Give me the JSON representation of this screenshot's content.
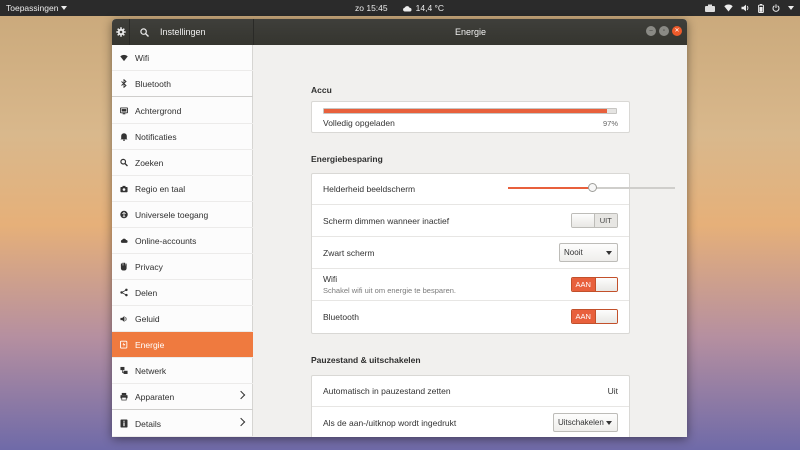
{
  "topbar": {
    "apps_label": "Toepassingen",
    "clock": "zo 15:45",
    "weather": "14,4 °C"
  },
  "window": {
    "app_title": "Instellingen",
    "panel_title": "Energie"
  },
  "sidebar": {
    "items": [
      {
        "label": "Wifi",
        "icon": "wifi-icon"
      },
      {
        "label": "Bluetooth",
        "icon": "bluetooth-icon"
      },
      {
        "label": "Achtergrond",
        "icon": "background-icon"
      },
      {
        "label": "Notificaties",
        "icon": "bell-icon"
      },
      {
        "label": "Zoeken",
        "icon": "search-icon"
      },
      {
        "label": "Regio en taal",
        "icon": "camera-icon"
      },
      {
        "label": "Universele toegang",
        "icon": "accessibility-icon"
      },
      {
        "label": "Online-accounts",
        "icon": "cloud-icon"
      },
      {
        "label": "Privacy",
        "icon": "hand-icon"
      },
      {
        "label": "Delen",
        "icon": "share-icon"
      },
      {
        "label": "Geluid",
        "icon": "speaker-icon"
      },
      {
        "label": "Energie",
        "icon": "power-icon",
        "active": true
      },
      {
        "label": "Netwerk",
        "icon": "network-icon"
      },
      {
        "label": "Apparaten",
        "icon": "printer-icon"
      },
      {
        "label": "Details",
        "icon": "info-icon"
      }
    ]
  },
  "accu": {
    "title": "Accu",
    "status": "Volledig opgeladen",
    "percent_label": "97%",
    "level": 0.97
  },
  "power_saving": {
    "title": "Energiebesparing",
    "brightness_label": "Helderheid beeldscherm",
    "brightness_level": 0.5,
    "dim_label": "Scherm dimmen wanneer inactief",
    "dim_state": "UIT",
    "blank_label": "Zwart scherm",
    "blank_value": "Nooit",
    "wifi_label": "Wifi",
    "wifi_sub": "Schakel wifi uit om energie te besparen.",
    "wifi_state": "AAN",
    "bluetooth_label": "Bluetooth",
    "bluetooth_state": "AAN"
  },
  "suspend": {
    "title": "Pauzestand & uitschakelen",
    "auto_label": "Automatisch in pauzestand zetten",
    "auto_value": "Uit",
    "button_label": "Als de aan-/uitknop wordt ingedrukt",
    "button_value": "Uitschakelen"
  },
  "colors": {
    "accent": "#ef7a3f",
    "bar": "#e8603c"
  }
}
